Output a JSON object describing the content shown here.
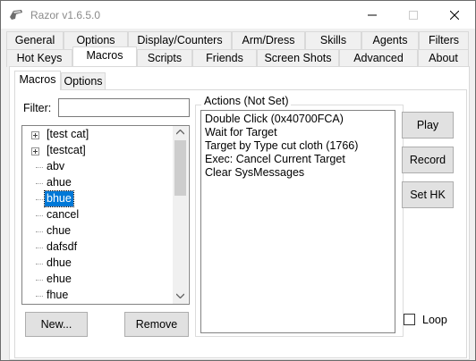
{
  "window": {
    "title": "Razor v1.6.5.0"
  },
  "tabs_row1": [
    "General",
    "Options",
    "Display/Counters",
    "Arm/Dress",
    "Skills",
    "Agents",
    "Filters"
  ],
  "tabs_row2": [
    "Hot Keys",
    "Macros",
    "Scripts",
    "Friends",
    "Screen Shots",
    "Advanced",
    "About"
  ],
  "active_tab": "Macros",
  "subtabs": [
    "Macros",
    "Options"
  ],
  "filter": {
    "label": "Filter:",
    "value": ""
  },
  "tree": {
    "items": [
      {
        "label": "[test cat]",
        "expandable": true
      },
      {
        "label": "[testcat]",
        "expandable": true
      },
      {
        "label": "abv"
      },
      {
        "label": "ahue"
      },
      {
        "label": "bhue",
        "selected": true
      },
      {
        "label": "cancel"
      },
      {
        "label": "chue"
      },
      {
        "label": "dafsdf"
      },
      {
        "label": "dhue"
      },
      {
        "label": "ehue"
      },
      {
        "label": "fhue"
      }
    ]
  },
  "buttons": {
    "new": "New...",
    "remove": "Remove",
    "play": "Play",
    "record": "Record",
    "set_hk": "Set HK"
  },
  "actions_group": {
    "title": "Actions (Not Set)",
    "items": [
      "Double Click (0x40700FCA)",
      "Wait for Target",
      "Target by Type cut cloth (1766)",
      "Exec: Cancel Current Target",
      "Clear SysMessages"
    ]
  },
  "loop": {
    "label": "Loop",
    "checked": false
  },
  "colors": {
    "selection": "#0078d7",
    "client_bg": "#f0f0f0",
    "button_bg": "#e1e1e1"
  }
}
